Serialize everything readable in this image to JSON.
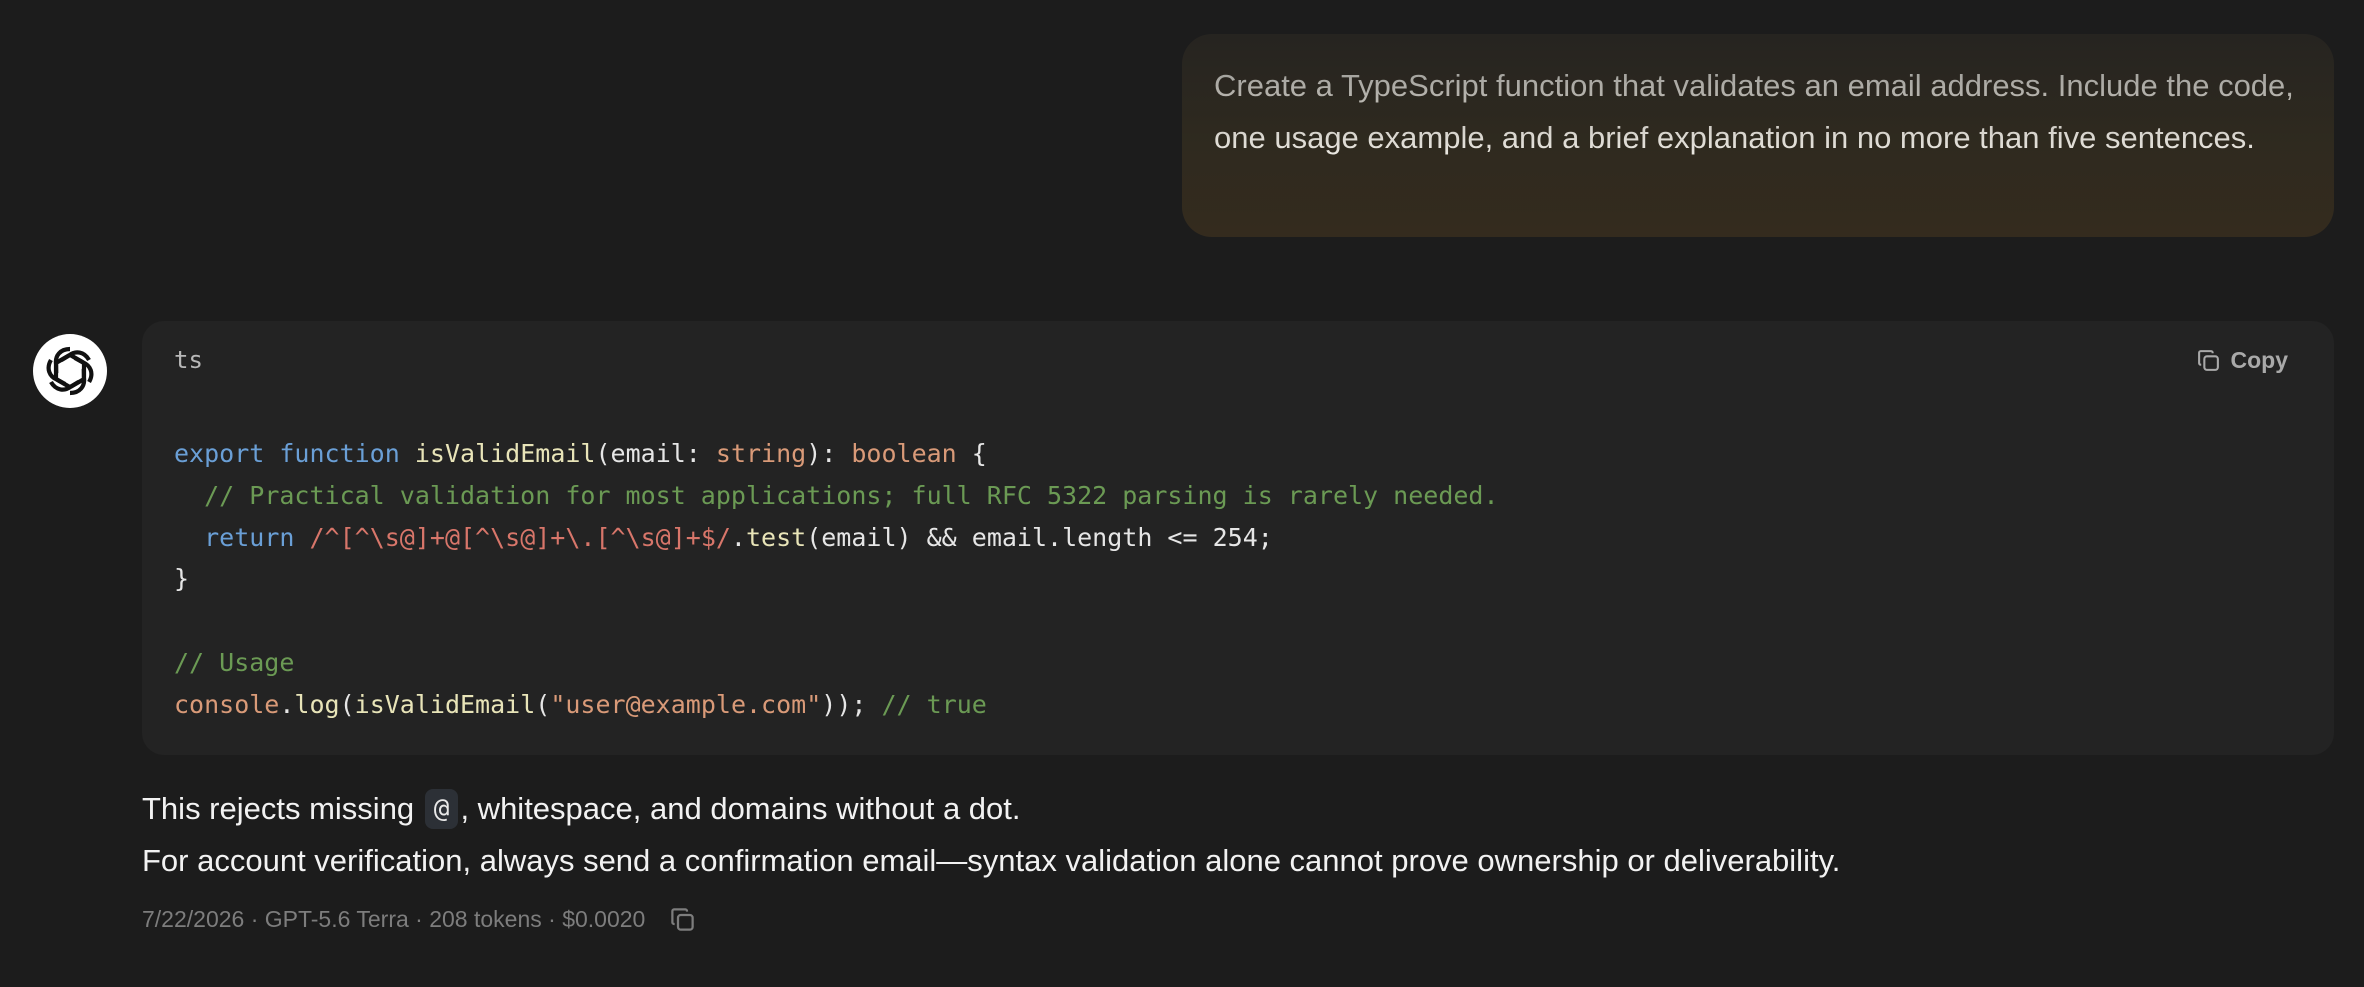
{
  "user_message": {
    "text": "Create a TypeScript function that validates an email address. Include the code, one usage example, and a brief explanation in no more than five sentences."
  },
  "assistant": {
    "avatar_icon": "openai-logo-icon",
    "code_block": {
      "language": "ts",
      "copy_label": "Copy",
      "copy_icon": "copy-icon",
      "lines": [
        {
          "tokens": [
            {
              "t": "export",
              "c": "kw"
            },
            {
              "t": " ",
              "c": "plain"
            },
            {
              "t": "function",
              "c": "kw"
            },
            {
              "t": " ",
              "c": "plain"
            },
            {
              "t": "isValidEmail",
              "c": "fn"
            },
            {
              "t": "(email: ",
              "c": "plain"
            },
            {
              "t": "string",
              "c": "type"
            },
            {
              "t": "): ",
              "c": "plain"
            },
            {
              "t": "boolean",
              "c": "type"
            },
            {
              "t": " {",
              "c": "plain"
            }
          ]
        },
        {
          "tokens": [
            {
              "t": "  ",
              "c": "plain"
            },
            {
              "t": "// Practical validation for most applications; full RFC 5322 parsing is rarely needed.",
              "c": "cmt"
            }
          ]
        },
        {
          "tokens": [
            {
              "t": "  ",
              "c": "plain"
            },
            {
              "t": "return",
              "c": "kw"
            },
            {
              "t": " ",
              "c": "plain"
            },
            {
              "t": "/^[^\\s@]+@[^\\s@]+\\.[^\\s@]+$/",
              "c": "re"
            },
            {
              "t": ".",
              "c": "plain"
            },
            {
              "t": "test",
              "c": "fn"
            },
            {
              "t": "(email) && email.length <= 254;",
              "c": "plain"
            }
          ]
        },
        {
          "tokens": [
            {
              "t": "}",
              "c": "plain"
            }
          ]
        },
        {
          "tokens": []
        },
        {
          "tokens": [
            {
              "t": "// Usage",
              "c": "cmt"
            }
          ]
        },
        {
          "tokens": [
            {
              "t": "console",
              "c": "obj"
            },
            {
              "t": ".",
              "c": "plain"
            },
            {
              "t": "log",
              "c": "fn"
            },
            {
              "t": "(",
              "c": "plain"
            },
            {
              "t": "isValidEmail",
              "c": "fn"
            },
            {
              "t": "(",
              "c": "plain"
            },
            {
              "t": "\"user@example.com\"",
              "c": "str"
            },
            {
              "t": ")); ",
              "c": "plain"
            },
            {
              "t": "// true",
              "c": "cmt"
            }
          ]
        }
      ]
    },
    "explanation": {
      "line1_before": "This rejects missing ",
      "line1_code": "@",
      "line1_after": ", whitespace, and domains without a dot.",
      "line2": "For account verification, always send a confirmation email—syntax validation alone cannot prove ownership or deliverability."
    },
    "meta": {
      "text": "7/22/2026 · GPT-5.6 Terra · 208 tokens · $0.0020",
      "copy_icon": "copy-icon"
    }
  }
}
